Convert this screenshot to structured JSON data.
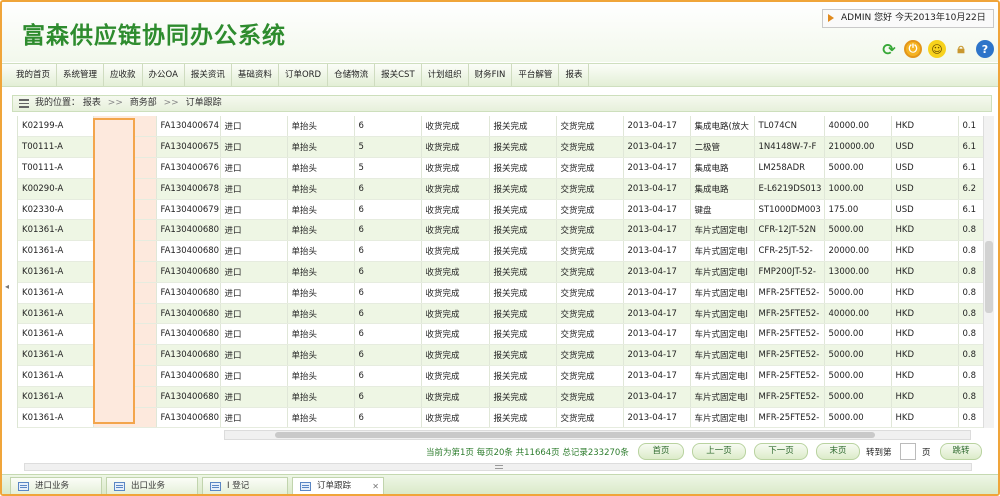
{
  "header": {
    "title": "富森供应链协同办公系统",
    "welcome": "ADMIN 您好 今天2013年10月22日"
  },
  "menu": [
    "我的首页",
    "系统管理",
    "应收款",
    "办公OA",
    "报关资讯",
    "基础资料",
    "订单ORD",
    "仓储物流",
    "报关CST",
    "计划组织",
    "财务FIN",
    "平台解管",
    "报表"
  ],
  "breadcrumb": {
    "label": "我的位置：",
    "items": [
      "报表",
      "商务部",
      "订单跟踪"
    ],
    "separator": ">>"
  },
  "table": {
    "rows": [
      [
        "K02199-A",
        "",
        "FA130400674",
        "进口",
        "单抬头",
        "6",
        "收货完成",
        "报关完成",
        "交货完成",
        "2013-04-17",
        "集成电路(放大",
        "TL074CN",
        "40000.00",
        "HKD",
        "0.1"
      ],
      [
        "T00111-A",
        "",
        "FA130400675",
        "进口",
        "单抬头",
        "5",
        "收货完成",
        "报关完成",
        "交货完成",
        "2013-04-17",
        "二极管",
        "1N4148W-7-F",
        "210000.00",
        "USD",
        "6.1"
      ],
      [
        "T00111-A",
        "",
        "FA130400676",
        "进口",
        "单抬头",
        "5",
        "收货完成",
        "报关完成",
        "交货完成",
        "2013-04-17",
        "集成电路",
        "LM258ADR",
        "5000.00",
        "USD",
        "6.1"
      ],
      [
        "K00290-A",
        "",
        "FA130400678",
        "进口",
        "单抬头",
        "6",
        "收货完成",
        "报关完成",
        "交货完成",
        "2013-04-17",
        "集成电路",
        "E-L6219DS013",
        "1000.00",
        "USD",
        "6.2"
      ],
      [
        "K02330-A",
        "",
        "FA130400679",
        "进口",
        "单抬头",
        "6",
        "收货完成",
        "报关完成",
        "交货完成",
        "2013-04-17",
        "键盘",
        "ST1000DM003",
        "175.00",
        "USD",
        "6.1"
      ],
      [
        "K01361-A",
        "",
        "FA130400680",
        "进口",
        "单抬头",
        "6",
        "收货完成",
        "报关完成",
        "交货完成",
        "2013-04-17",
        "车片式固定电l",
        "CFR-12JT-52N",
        "5000.00",
        "HKD",
        "0.8"
      ],
      [
        "K01361-A",
        "",
        "FA130400680",
        "进口",
        "单抬头",
        "6",
        "收货完成",
        "报关完成",
        "交货完成",
        "2013-04-17",
        "车片式固定电l",
        "CFR-25JT-52-",
        "20000.00",
        "HKD",
        "0.8"
      ],
      [
        "K01361-A",
        "",
        "FA130400680",
        "进口",
        "单抬头",
        "6",
        "收货完成",
        "报关完成",
        "交货完成",
        "2013-04-17",
        "车片式固定电l",
        "FMP200JT-52-",
        "13000.00",
        "HKD",
        "0.8"
      ],
      [
        "K01361-A",
        "",
        "FA130400680",
        "进口",
        "单抬头",
        "6",
        "收货完成",
        "报关完成",
        "交货完成",
        "2013-04-17",
        "车片式固定电l",
        "MFR-25FTE52-",
        "5000.00",
        "HKD",
        "0.8"
      ],
      [
        "K01361-A",
        "",
        "FA130400680",
        "进口",
        "单抬头",
        "6",
        "收货完成",
        "报关完成",
        "交货完成",
        "2013-04-17",
        "车片式固定电l",
        "MFR-25FTE52-",
        "40000.00",
        "HKD",
        "0.8"
      ],
      [
        "K01361-A",
        "",
        "FA130400680",
        "进口",
        "单抬头",
        "6",
        "收货完成",
        "报关完成",
        "交货完成",
        "2013-04-17",
        "车片式固定电l",
        "MFR-25FTE52-",
        "5000.00",
        "HKD",
        "0.8"
      ],
      [
        "K01361-A",
        "",
        "FA130400680",
        "进口",
        "单抬头",
        "6",
        "收货完成",
        "报关完成",
        "交货完成",
        "2013-04-17",
        "车片式固定电l",
        "MFR-25FTE52-",
        "5000.00",
        "HKD",
        "0.8"
      ],
      [
        "K01361-A",
        "",
        "FA130400680",
        "进口",
        "单抬头",
        "6",
        "收货完成",
        "报关完成",
        "交货完成",
        "2013-04-17",
        "车片式固定电l",
        "MFR-25FTE52-",
        "5000.00",
        "HKD",
        "0.8"
      ],
      [
        "K01361-A",
        "",
        "FA130400680",
        "进口",
        "单抬头",
        "6",
        "收货完成",
        "报关完成",
        "交货完成",
        "2013-04-17",
        "车片式固定电l",
        "MFR-25FTE52-",
        "5000.00",
        "HKD",
        "0.8"
      ],
      [
        "K01361-A",
        "",
        "FA130400680",
        "进口",
        "单抬头",
        "6",
        "收货完成",
        "报关完成",
        "交货完成",
        "2013-04-17",
        "车片式固定电l",
        "MFR-25FTE52-",
        "5000.00",
        "HKD",
        "0.8"
      ]
    ]
  },
  "pager": {
    "info": "当前为第1页 每页20条 共11664页 总记录233270条",
    "first": "首页",
    "prev": "上一页",
    "next": "下一页",
    "last": "末页",
    "goto_label": "转到第",
    "page_unit": "页",
    "go": "跳转"
  },
  "tabs": [
    "进口业务",
    "出口业务",
    "I 登记",
    "订单跟踪"
  ],
  "colors": {
    "accent": "#2e8c2e",
    "frame": "#f0a53a",
    "row_alt": "#eef6e4"
  },
  "icons": [
    "refresh-icon",
    "power-icon",
    "smile-icon",
    "lock-icon",
    "help-icon"
  ]
}
